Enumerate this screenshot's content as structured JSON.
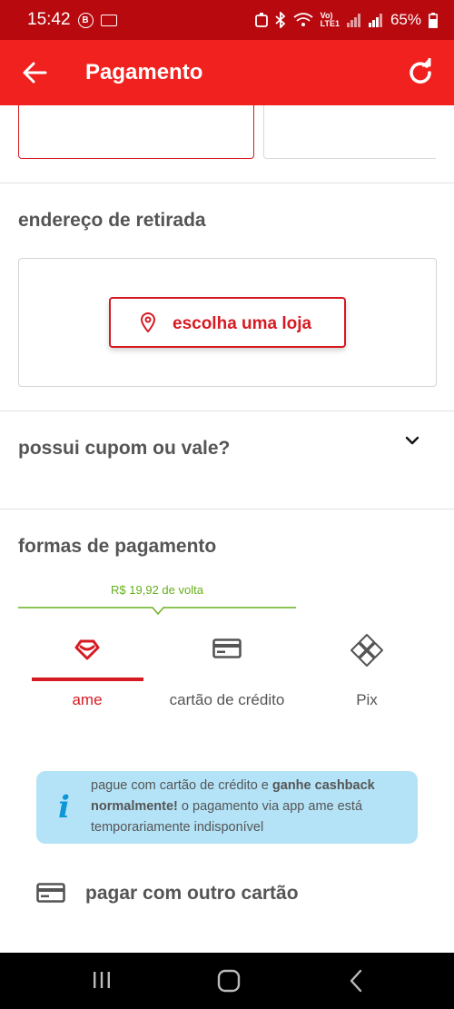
{
  "status_bar": {
    "time": "15:42",
    "icon_b": "B",
    "network": "Vo)\nLTE1",
    "battery": "65%"
  },
  "app_bar": {
    "title": "Pagamento"
  },
  "pickup": {
    "title": "endereço de retirada",
    "store_button": "escolha uma loja"
  },
  "coupon": {
    "title": "possui cupom ou vale?"
  },
  "payment": {
    "title": "formas de pagamento",
    "cashback": "R$ 19,92 de volta",
    "tabs": [
      {
        "label": "ame",
        "icon": "ame-heart-icon",
        "selected": true
      },
      {
        "label": "cartão de crédito",
        "icon": "credit-card-icon",
        "selected": false
      },
      {
        "label": "Pix",
        "icon": "pix-icon",
        "selected": false
      }
    ],
    "info": {
      "part1": "pague com cartão de crédito e ",
      "bold": "ganhe cashback normalmente!",
      "part2": " o pagamento via app ame está temporariamente indisponível"
    },
    "other_card": "pagar com outro cartão"
  },
  "colors": {
    "brand_red": "#f0211f",
    "status_red": "#b8090f",
    "accent_red": "#d51a22",
    "cashback_green": "#66b01a",
    "info_bg": "#b4e3f7",
    "info_icon": "#0e96d6"
  }
}
